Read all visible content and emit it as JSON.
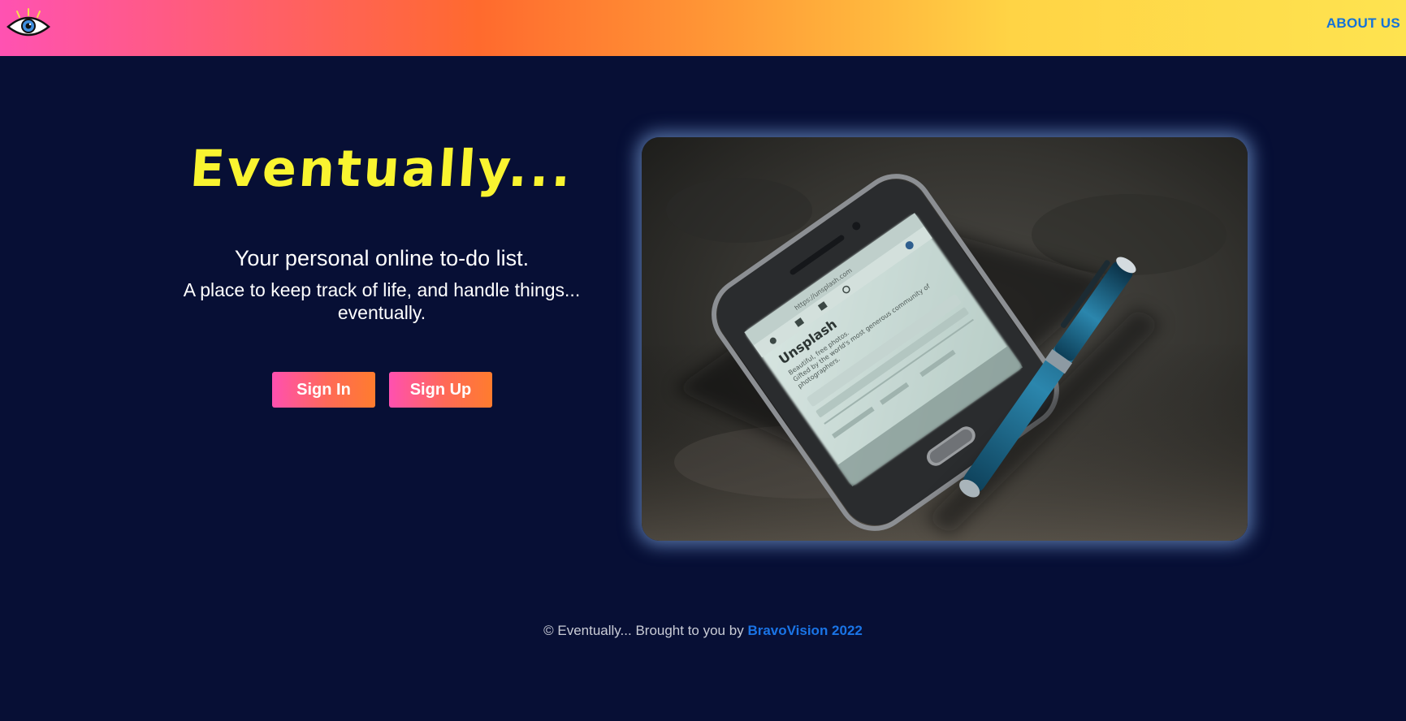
{
  "nav": {
    "logo": "eye-logo",
    "about_label": "ABOUT US"
  },
  "hero": {
    "title": "Eventually...",
    "tagline": "Your personal online to-do list.",
    "subtag": "A place to keep track of life, and handle things... eventually.",
    "signin_label": "Sign In",
    "signup_label": "Sign Up",
    "image": {
      "brand_text": "Unsplash",
      "url_text": "https://unsplash.com",
      "lines": [
        "Beautiful, free photos.",
        "Gifted by the world's most generous community of",
        "photographers."
      ]
    }
  },
  "footer": {
    "prefix": "© Eventually... Brought to you by",
    "brand": "BravoVision 2022"
  },
  "colors": {
    "background": "#070f35",
    "title": "#f9f430",
    "link": "#1472d8",
    "button_gradient_start": "#ff50b0",
    "button_gradient_end": "#ff7c2e"
  }
}
